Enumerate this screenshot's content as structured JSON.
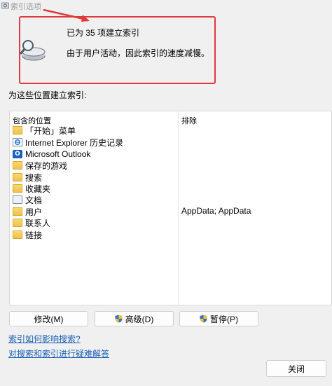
{
  "window": {
    "title": "索引选项"
  },
  "status": {
    "count_text": "已为 35 项建立索引",
    "detail_text": "由于用户活动，因此索引的速度减慢。"
  },
  "locations": {
    "section_label": "为这些位置建立索引:",
    "column_included": "包含的位置",
    "column_excluded": "排除",
    "rows": [
      {
        "icon": "folder-icon",
        "label": "「开始」菜单",
        "exclude": ""
      },
      {
        "icon": "internet-explorer-icon",
        "label": "Internet Explorer 历史记录",
        "exclude": ""
      },
      {
        "icon": "outlook-icon",
        "label": "Microsoft Outlook",
        "exclude": ""
      },
      {
        "icon": "folder-icon",
        "label": "保存的游戏",
        "exclude": ""
      },
      {
        "icon": "folder-icon",
        "label": "搜索",
        "exclude": ""
      },
      {
        "icon": "folder-icon",
        "label": "收藏夹",
        "exclude": ""
      },
      {
        "icon": "document-icon",
        "label": "文档",
        "exclude": ""
      },
      {
        "icon": "folder-icon",
        "label": "用户",
        "exclude": "AppData; AppData"
      },
      {
        "icon": "folder-icon",
        "label": "联系人",
        "exclude": ""
      },
      {
        "icon": "folder-icon",
        "label": "链接",
        "exclude": ""
      }
    ]
  },
  "buttons": {
    "modify": "修改(M)",
    "advanced": "高级(D)",
    "pause": "暂停(P)",
    "close": "关闭"
  },
  "links": {
    "affect": "索引如何影响搜索?",
    "troubleshoot": "对搜索和索引进行疑难解答"
  },
  "colors": {
    "highlight_border": "#e03a3a",
    "link": "#1a5fb4",
    "folder": "#f0c24a"
  }
}
